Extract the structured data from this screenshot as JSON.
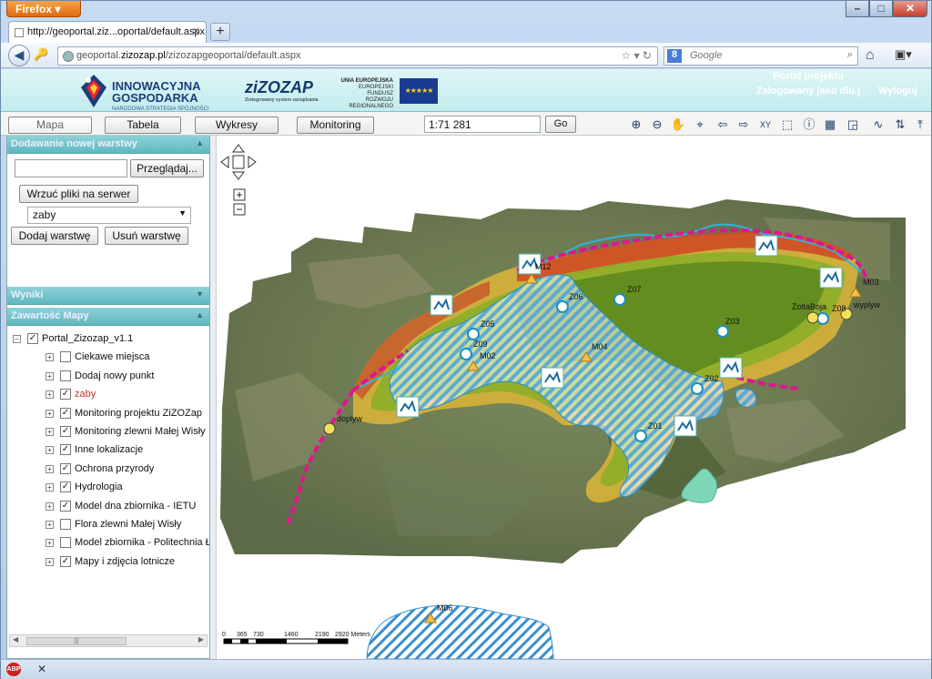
{
  "browser": {
    "app_button": "Firefox",
    "tab_title": "http://geoportal.ziz...oportal/default.aspx",
    "url_prefix": "geoportal.",
    "url_domain": "zizozap.pl",
    "url_path": "/zizozapgeoportal/default.aspx",
    "search_placeholder": "Google",
    "search_engine_logo": "8"
  },
  "banner": {
    "logo1_title": "INNOWACYJNA\nGOSPODARKA",
    "logo1_line1": "INNOWACYJNA",
    "logo1_line2": "GOSPODARKA",
    "logo1_sub": "NARODOWA STRATEGIA SPÓJNOŚCI",
    "logo2": "ziZOZAP",
    "logo2_sub": "Zintegrowany system zarządzania",
    "ue_line1": "UNIA EUROPEJSKA",
    "ue_line2": "EUROPEJSKI FUNDUSZ",
    "ue_line3": "ROZWOJU REGIONALNEGO",
    "portal": "Portal projektu",
    "logged": "Zalogowany jako dlu.j",
    "logout": "Wyloguj"
  },
  "toolbar": {
    "tabs": [
      "Mapa",
      "Tabela",
      "Wykresy",
      "Monitoring"
    ],
    "scale_value": "1:71 281",
    "go_label": "Go"
  },
  "panel_add": {
    "title": "Dodawanie nowej warstwy",
    "browse": "Przeglądaj...",
    "upload": "Wrzuć pliki na serwer",
    "selected": "zaby",
    "add": "Dodaj warstwę",
    "remove": "Usuń warstwę"
  },
  "panel_results": {
    "title": "Wyniki"
  },
  "panel_contents": {
    "title": "Zawartość Mapy",
    "root": "Portal_Zizozap_v1.1",
    "layers": [
      {
        "label": "Ciekawe miejsca",
        "checked": false,
        "color": "#111111"
      },
      {
        "label": "Dodaj nowy punkt",
        "checked": false,
        "color": "#111111"
      },
      {
        "label": "zaby",
        "checked": true,
        "color": "#c0392b"
      },
      {
        "label": "Monitoring projektu ZiZOZap",
        "checked": true,
        "color": "#111111"
      },
      {
        "label": "Monitoring zlewni Małej Wisły",
        "checked": true,
        "color": "#111111"
      },
      {
        "label": "Inne lokalizacje",
        "checked": true,
        "color": "#111111"
      },
      {
        "label": "Ochrona przyrody",
        "checked": true,
        "color": "#111111"
      },
      {
        "label": "Hydrologia",
        "checked": true,
        "color": "#111111"
      },
      {
        "label": "Model dna zbiornika - IETU",
        "checked": true,
        "color": "#111111"
      },
      {
        "label": "Flora zlewni Małej Wisły",
        "checked": false,
        "color": "#111111"
      },
      {
        "label": "Model zbiornika - Politechnia Ł",
        "checked": false,
        "color": "#111111"
      },
      {
        "label": "Mapy i zdjęcia lotnicze",
        "checked": true,
        "color": "#111111"
      }
    ]
  },
  "map": {
    "labels": {
      "m12": "M12",
      "z06": "Z06",
      "z07": "Z07",
      "m03": "M03",
      "zolta_boja": "ZoltaBoja",
      "z08": "Z08",
      "wyplyw": "wyplyw",
      "z05": "Z05",
      "z03": "Z03",
      "z09": "Z09",
      "m02": "M02",
      "m04": "M04",
      "z02": "Z02",
      "doplyw": "doplyw",
      "z01": "Z01",
      "m06": "M06"
    },
    "scalebar": {
      "ticks": [
        "0",
        "365",
        "730",
        "1460",
        "2190",
        "2920 Meters"
      ]
    }
  },
  "colors": {
    "accent": "#5fb8c0",
    "water_hatch": "#3a8fd0",
    "shoreline_magenta": "#e0168e",
    "wetland": "#7fd6b7"
  }
}
